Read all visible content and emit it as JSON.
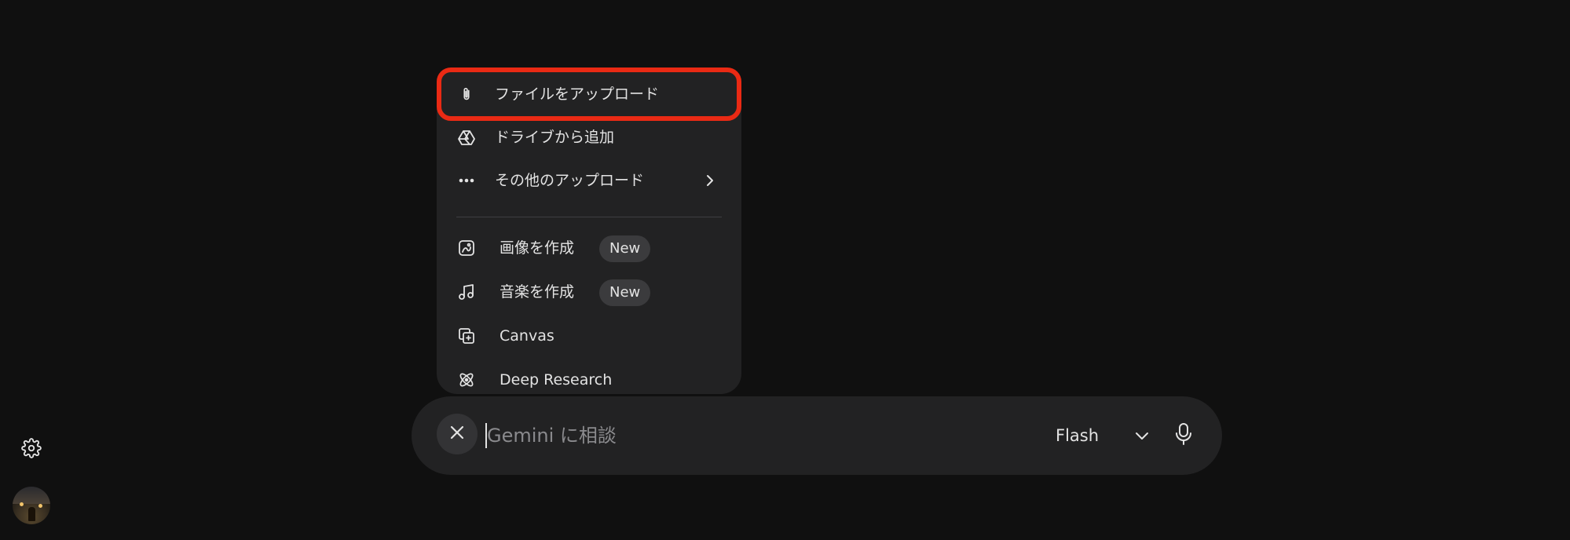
{
  "sidebar": {
    "settings_icon": "gear-icon",
    "avatar_icon": "user-avatar"
  },
  "menu": {
    "items": [
      {
        "label": "ファイルをアップロード",
        "icon": "paperclip-icon"
      },
      {
        "label": "ドライブから追加",
        "icon": "drive-icon"
      },
      {
        "label": "その他のアップロード",
        "icon": "more-horizontal-icon",
        "submenu": true
      }
    ],
    "tools": [
      {
        "label": "画像を作成",
        "icon": "image-create-icon",
        "badge": "New"
      },
      {
        "label": "音楽を作成",
        "icon": "music-note-icon",
        "badge": "New"
      },
      {
        "label": "Canvas",
        "icon": "canvas-icon"
      },
      {
        "label": "Deep Research",
        "icon": "deep-research-icon"
      }
    ],
    "highlight_color": "#ea2a14"
  },
  "input": {
    "placeholder": "Gemini に相談",
    "value": "",
    "model_label": "Flash",
    "close_icon": "close-icon",
    "mic_icon": "microphone-icon"
  },
  "colors": {
    "background": "#101010",
    "surface": "#222223",
    "text": "#e3e3e3",
    "badge_bg": "#3b3b3d"
  }
}
